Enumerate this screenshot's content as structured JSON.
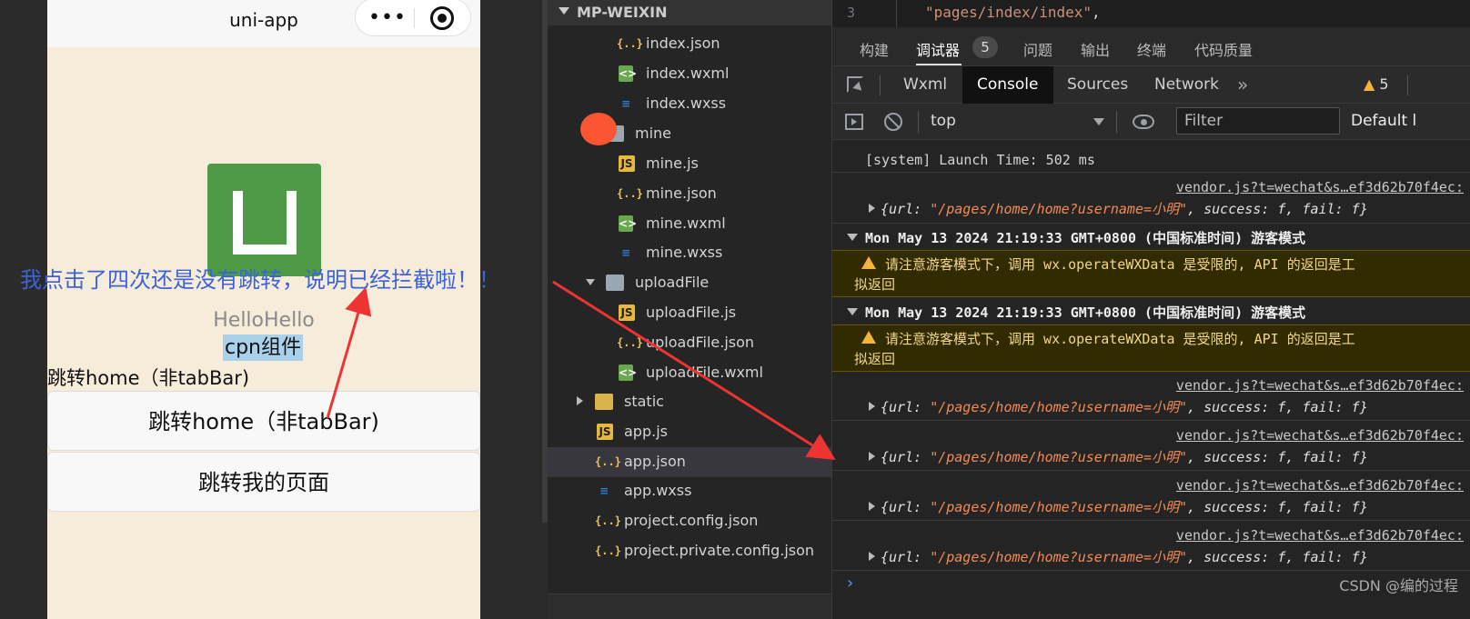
{
  "simulator": {
    "nav_title": "uni-app",
    "capsule_dots": "•••",
    "hello_text": "HelloHello",
    "cpn_text": "cpn组件",
    "link_text": "跳转home（非tabBar)",
    "button1_label": "跳转home（非tabBar)",
    "button2_label": "跳转我的页面",
    "logo_color": "#4e9a47",
    "background_color": "#f7ebda"
  },
  "annotation": {
    "text": "我点击了四次还是没有跳转，说明已经拦截啦！！",
    "color": "#3b63d8",
    "arrow_color": "#ee3333"
  },
  "explorer": {
    "root_label": "MP-WEIXIN",
    "items": [
      {
        "label": "index.json",
        "icon": "json-icon"
      },
      {
        "label": "index.wxml",
        "icon": "wxml-icon"
      },
      {
        "label": "index.wxss",
        "icon": "wxss-icon"
      },
      {
        "label": "mine",
        "icon": "folder-icon"
      },
      {
        "label": "mine.js",
        "icon": "js-icon"
      },
      {
        "label": "mine.json",
        "icon": "json-icon"
      },
      {
        "label": "mine.wxml",
        "icon": "wxml-icon"
      },
      {
        "label": "mine.wxss",
        "icon": "wxss-icon"
      },
      {
        "label": "uploadFile",
        "icon": "folder-icon"
      },
      {
        "label": "uploadFile.js",
        "icon": "js-icon"
      },
      {
        "label": "uploadFile.json",
        "icon": "json-icon"
      },
      {
        "label": "uploadFile.wxml",
        "icon": "wxml-icon"
      },
      {
        "label": "static",
        "icon": "folder-icon"
      },
      {
        "label": "app.js",
        "icon": "js-icon"
      },
      {
        "label": "app.json",
        "icon": "json-icon"
      },
      {
        "label": "app.wxss",
        "icon": "wxss-icon"
      },
      {
        "label": "project.config.json",
        "icon": "json-icon"
      },
      {
        "label": "project.private.config.json",
        "icon": "json-icon"
      }
    ],
    "selected": "app.json"
  },
  "editor": {
    "line_number": "3",
    "code": "\"pages/index/index\"",
    "code_suffix": ","
  },
  "devtools": {
    "top_tabs": [
      "构建",
      "调试器",
      "问题",
      "输出",
      "终端",
      "代码质量"
    ],
    "active_top_tab": "调试器",
    "debugger_badge": "5",
    "panel_tabs": [
      "Wxml",
      "Console",
      "Sources",
      "Network"
    ],
    "active_panel_tab": "Console",
    "more_label": "»",
    "warning_count": "5",
    "context": "top",
    "filter_placeholder": "Filter",
    "levels_label": "Default l"
  },
  "console": {
    "launch_line": "[system] Launch Time: 502 ms",
    "source_link": "vendor.js?t=wechat&s…ef3d62b70f4ec:",
    "obj_prefix": "{url: ",
    "obj_url": "\"/pages/home/home?username=小明\"",
    "obj_suffix": ", success: f, fail: f}",
    "group_header": "Mon May 13 2024 21:19:33 GMT+0800 (中国标准时间) 游客模式",
    "warning_line1": "请注意游客模式下，调用 wx.operateWXData 是受限的, API 的返回是工",
    "warning_line2": "拟返回",
    "prompt": "›",
    "watermark": "CSDN @编的过程"
  }
}
